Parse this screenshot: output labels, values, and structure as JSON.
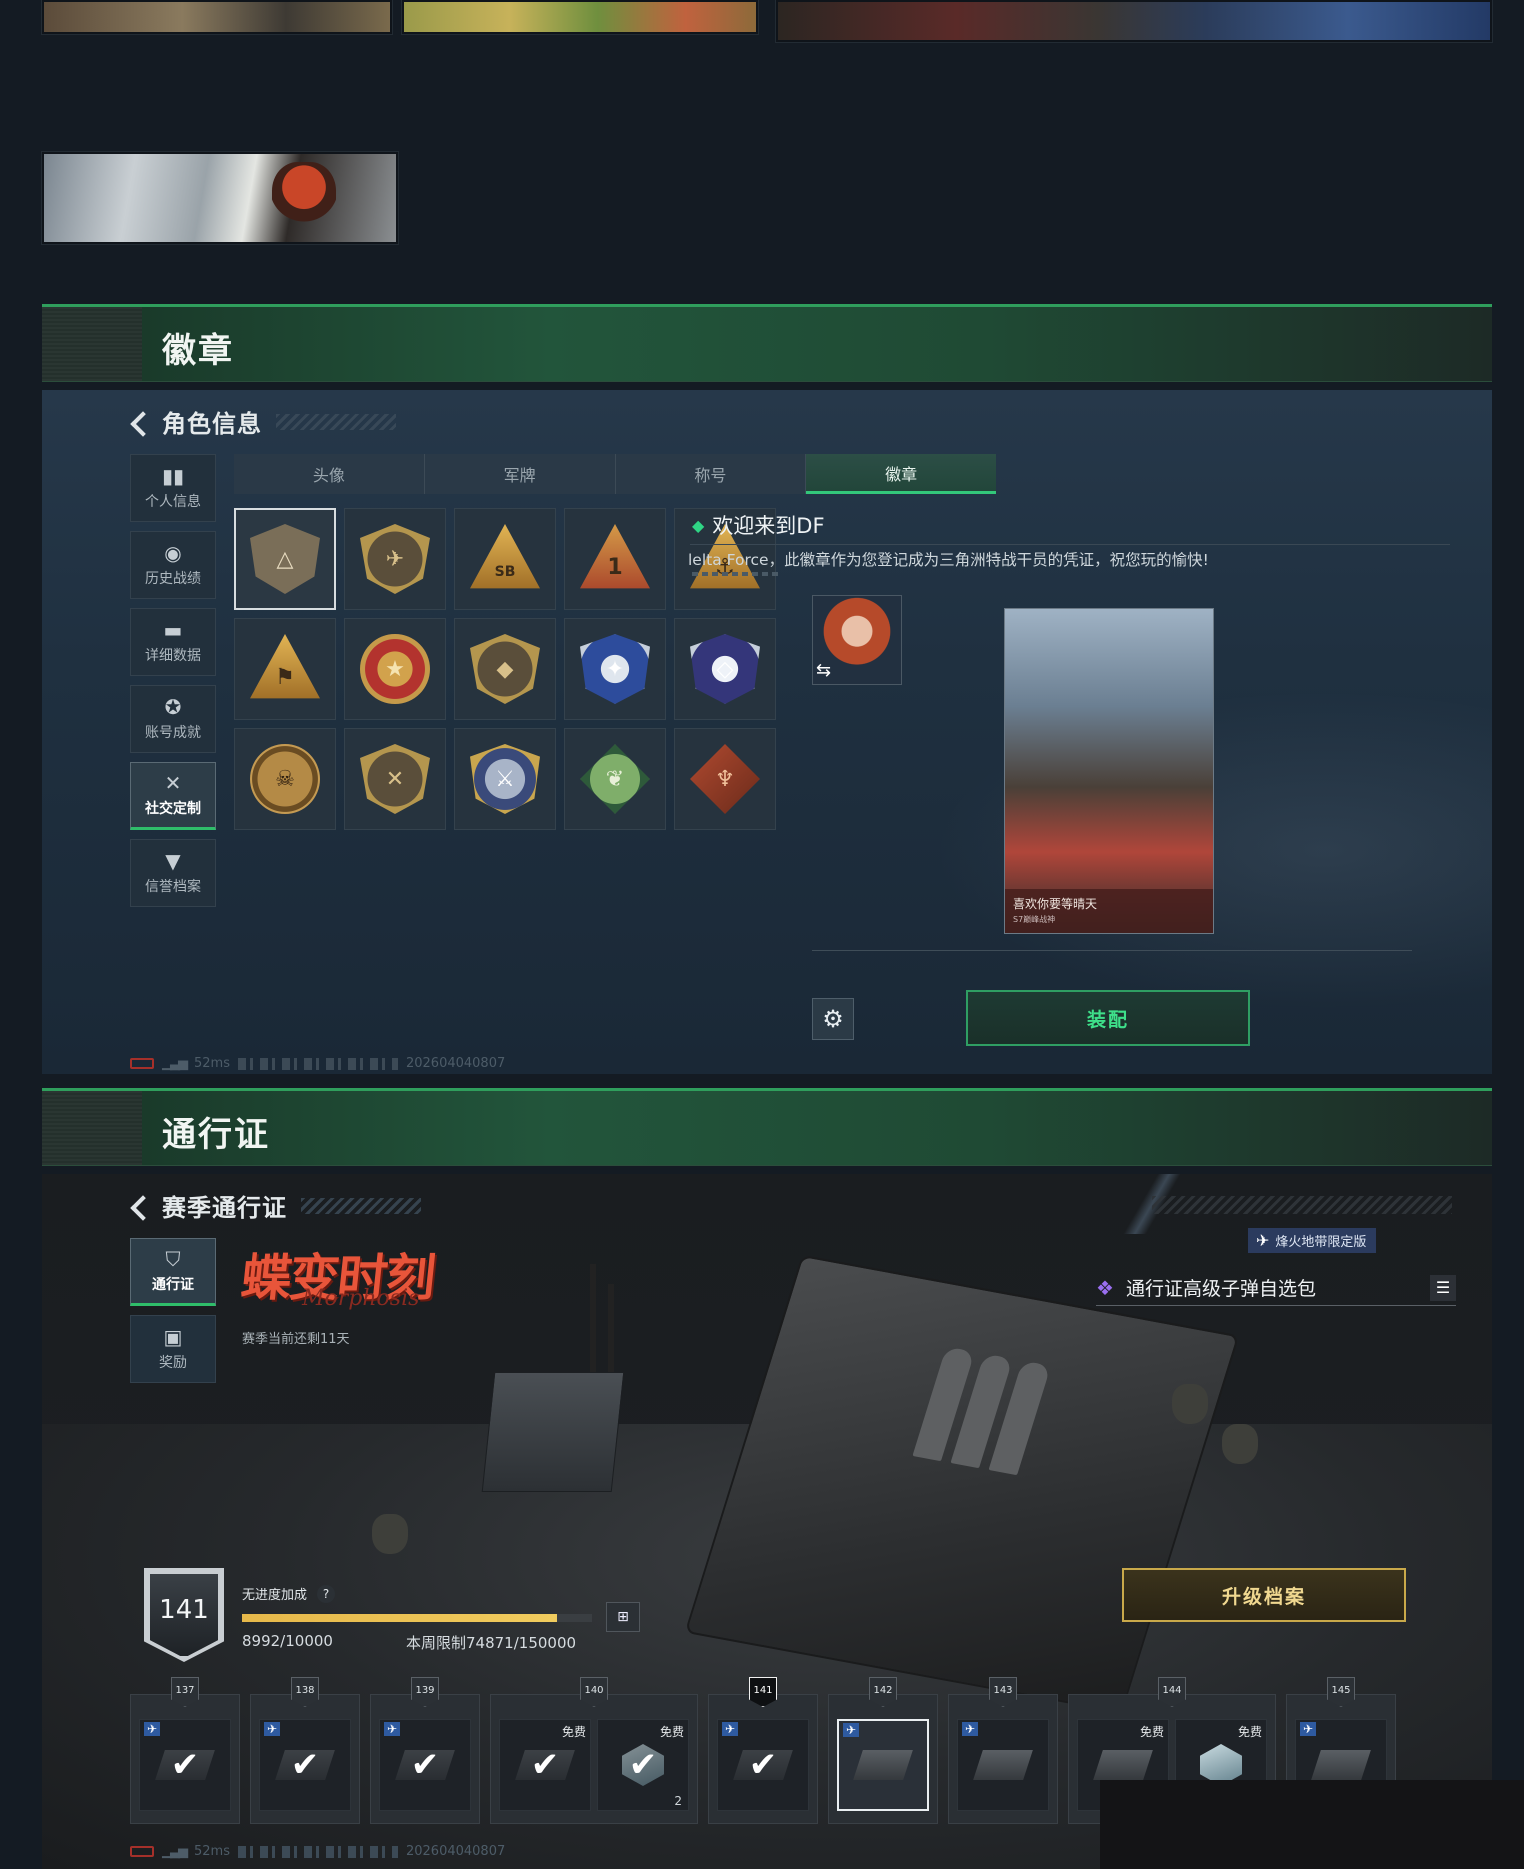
{
  "badge_section": {
    "header_title": "徽章",
    "back_title": "角色信息",
    "nav": [
      {
        "icon": "bar-chart-icon",
        "label": "个人信息"
      },
      {
        "icon": "history-icon",
        "label": "历史战绩"
      },
      {
        "icon": "folder-icon",
        "label": "详细数据"
      },
      {
        "icon": "achievement-icon",
        "label": "账号成就"
      },
      {
        "icon": "tools-icon",
        "label": "社交定制"
      },
      {
        "icon": "credit-icon",
        "label": "信誉档案"
      }
    ],
    "tabs": [
      "头像",
      "军牌",
      "称号",
      "徽章"
    ],
    "active_tab": "徽章",
    "badges": [
      {
        "name": "df-welcome-badge",
        "glyph": "△"
      },
      {
        "name": "helicopter-badge",
        "glyph": "✈"
      },
      {
        "name": "sb-badge",
        "glyph": "SB"
      },
      {
        "name": "rank-one-badge",
        "glyph": "1"
      },
      {
        "name": "diver-badge",
        "glyph": "⚓"
      },
      {
        "name": "squad-badge",
        "glyph": "⚑"
      },
      {
        "name": "star-medal-badge",
        "glyph": "★"
      },
      {
        "name": "wing-shield-badge",
        "glyph": "◆"
      },
      {
        "name": "blue-star-badge",
        "glyph": "✦"
      },
      {
        "name": "blue-gem-badge",
        "glyph": "◇"
      },
      {
        "name": "skull-target-badge",
        "glyph": "☠"
      },
      {
        "name": "rifle-badge",
        "glyph": "✕"
      },
      {
        "name": "crossed-arms-badge",
        "glyph": "⚔"
      },
      {
        "name": "eagle-badge",
        "glyph": "❦"
      },
      {
        "name": "dragon-badge",
        "glyph": "♆"
      }
    ],
    "detail_title": "欢迎来到DF",
    "detail_desc": "lelta Force，此徽章作为您登记成为三角洲特战干员的凭证，祝您玩的愉快!",
    "card_caption": "喜欢你要等晴天",
    "card_subcaption": "S7巅峰战神",
    "equip_label": "装配",
    "status": {
      "ping": "52ms",
      "build": "202604040807"
    }
  },
  "pass_section": {
    "header_title": "通行证",
    "back_title": "赛季通行证",
    "nav": [
      {
        "icon": "pass-icon",
        "label": "通行证"
      },
      {
        "icon": "gift-icon",
        "label": "奖励"
      }
    ],
    "season_logo": "蝶变时刻",
    "season_logo_sub": "Morphosis",
    "days_left": "赛季当前还剩11天",
    "limited_tag": "烽火地带限定版",
    "reward_title": "通行证高级子弹自选包",
    "level": "141",
    "boost_label": "无进度加成",
    "xp_current": 8992,
    "xp_max": 10000,
    "xp_text": "8992/10000",
    "weekly_text": "本周限制74871/150000",
    "upgrade_label": "升级档案",
    "tiers": [
      {
        "num": "137",
        "items": [
          {
            "type": "check",
            "heli": true
          }
        ]
      },
      {
        "num": "138",
        "items": [
          {
            "type": "check",
            "heli": true
          }
        ]
      },
      {
        "num": "139",
        "items": [
          {
            "type": "check",
            "heli": true
          }
        ]
      },
      {
        "num": "140",
        "items": [
          {
            "type": "check",
            "free": "免费"
          },
          {
            "type": "check-gem",
            "free": "免费",
            "qty": "2"
          }
        ]
      },
      {
        "num": "141",
        "current": true,
        "items": [
          {
            "type": "check",
            "heli": true
          }
        ]
      },
      {
        "num": "142",
        "items": [
          {
            "type": "box",
            "heli": true,
            "selected": true
          }
        ]
      },
      {
        "num": "143",
        "items": [
          {
            "type": "box",
            "heli": true
          }
        ]
      },
      {
        "num": "144",
        "items": [
          {
            "type": "box",
            "free": "免费"
          },
          {
            "type": "gem",
            "free": "免费"
          }
        ]
      },
      {
        "num": "145",
        "items": [
          {
            "type": "box",
            "heli": true
          }
        ]
      }
    ],
    "status": {
      "ping": "52ms",
      "build": "202604040807"
    }
  },
  "colors": {
    "accent_green": "#2fbd6a",
    "gold": "#c9a94a",
    "xp_bar": "#f1cc5e"
  }
}
